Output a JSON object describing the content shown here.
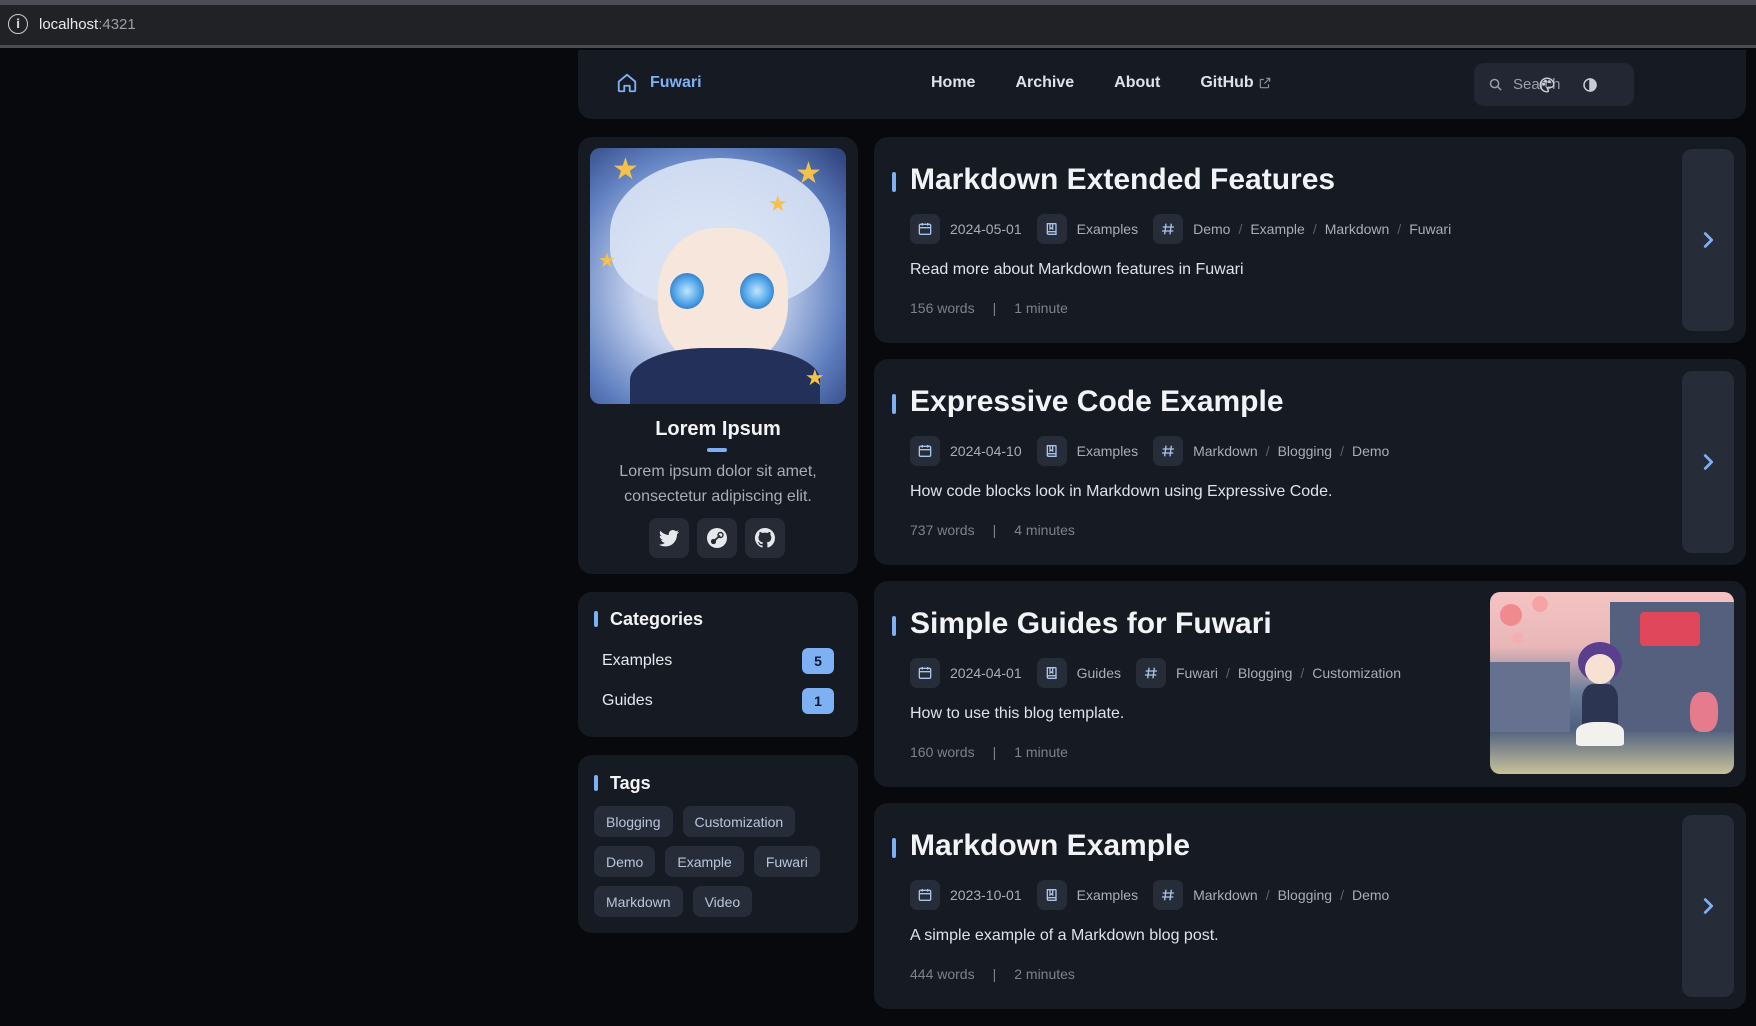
{
  "browser": {
    "url_host": "localhost",
    "url_port": ":4321"
  },
  "navbar": {
    "brand": "Fuwari",
    "links": [
      {
        "label": "Home"
      },
      {
        "label": "Archive"
      },
      {
        "label": "About"
      },
      {
        "label": "GitHub",
        "external": true
      }
    ],
    "search_placeholder": "Search",
    "accent_color": "#7db1f3"
  },
  "profile": {
    "name": "Lorem Ipsum",
    "bio": "Lorem ipsum dolor sit amet, consectetur adipiscing elit.",
    "socials": [
      "twitter-icon",
      "steam-icon",
      "github-icon"
    ]
  },
  "categories": {
    "title": "Categories",
    "items": [
      {
        "label": "Examples",
        "count": "5"
      },
      {
        "label": "Guides",
        "count": "1"
      }
    ]
  },
  "tags": {
    "title": "Tags",
    "items": [
      "Blogging",
      "Customization",
      "Demo",
      "Example",
      "Fuwari",
      "Markdown",
      "Video"
    ]
  },
  "posts": [
    {
      "title": "Markdown Extended Features",
      "date": "2024-05-01",
      "category": "Examples",
      "tags": [
        "Demo",
        "Example",
        "Markdown",
        "Fuwari"
      ],
      "description": "Read more about Markdown features in Fuwari",
      "words": "156 words",
      "time": "1 minute",
      "has_cover": false
    },
    {
      "title": "Expressive Code Example",
      "date": "2024-04-10",
      "category": "Examples",
      "tags": [
        "Markdown",
        "Blogging",
        "Demo"
      ],
      "description": "How code blocks look in Markdown using Expressive Code.",
      "words": "737 words",
      "time": "4 minutes",
      "has_cover": false
    },
    {
      "title": "Simple Guides for Fuwari",
      "date": "2024-04-01",
      "category": "Guides",
      "tags": [
        "Fuwari",
        "Blogging",
        "Customization"
      ],
      "description": "How to use this blog template.",
      "words": "160 words",
      "time": "1 minute",
      "has_cover": true
    },
    {
      "title": "Markdown Example",
      "date": "2023-10-01",
      "category": "Examples",
      "tags": [
        "Markdown",
        "Blogging",
        "Demo"
      ],
      "description": "A simple example of a Markdown blog post.",
      "words": "444 words",
      "time": "2 minutes",
      "has_cover": false
    }
  ]
}
